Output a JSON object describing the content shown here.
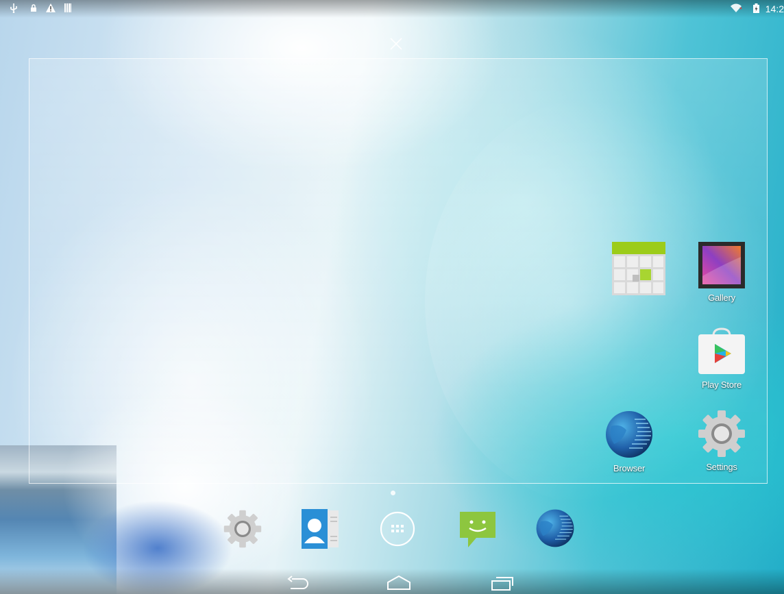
{
  "status_bar": {
    "icons": [
      "usb-icon",
      "lock-icon",
      "warning-icon",
      "signal-bars-icon",
      "wifi-icon",
      "battery-icon"
    ],
    "time": "14:2"
  },
  "home": {
    "apps": [
      {
        "name": "calendar",
        "label": ""
      },
      {
        "name": "gallery",
        "label": "Gallery"
      },
      {
        "name": "play-store",
        "label": "Play Store"
      },
      {
        "name": "browser",
        "label": "Browser"
      },
      {
        "name": "settings",
        "label": "Settings"
      }
    ]
  },
  "dock": {
    "items": [
      "settings",
      "contacts",
      "all-apps",
      "messaging",
      "browser"
    ]
  },
  "nav_bar": {
    "buttons": [
      "back",
      "home",
      "recent-apps"
    ]
  },
  "colors": {
    "calendar_green": "#9ccc1a",
    "messaging_green": "#8dc63f",
    "contacts_blue": "#2a8fd6",
    "browser_blue": "#1f5fa8",
    "settings_gray": "#c9c9c9"
  }
}
